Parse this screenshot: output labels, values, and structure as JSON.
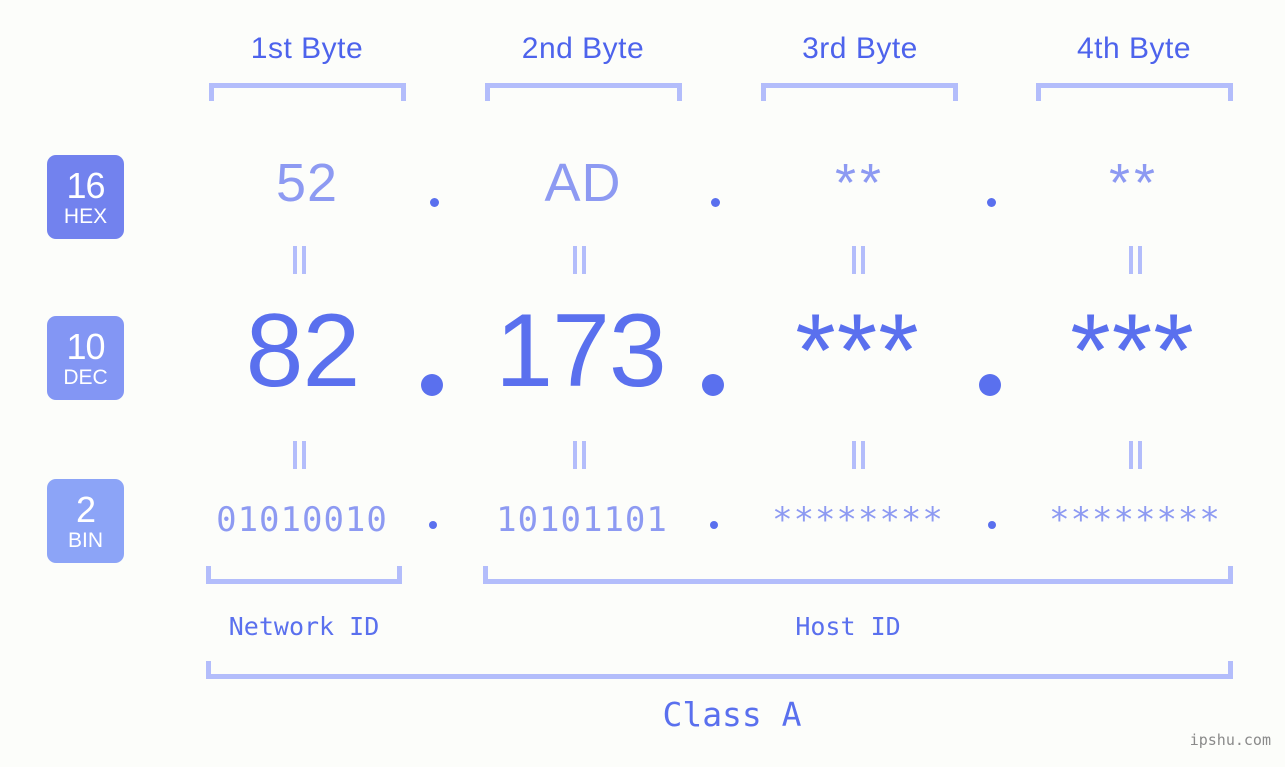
{
  "background_color": "#fcfdfa",
  "accent_colors": {
    "strong_blue": "#5a70ee",
    "light_blue": "#8d9af2",
    "bracket_blue": "#b3bdfb",
    "badge_hex": "#7282ee",
    "badge_dec": "#8396f4",
    "badge_bin": "#8ca4f7",
    "watermark_gray": "#8a8a8a"
  },
  "byte_headers": [
    {
      "label": "1st Byte"
    },
    {
      "label": "2nd Byte"
    },
    {
      "label": "3rd Byte"
    },
    {
      "label": "4th Byte"
    }
  ],
  "radix_badges": [
    {
      "number": "16",
      "name": "HEX",
      "color": "#7282ee"
    },
    {
      "number": "10",
      "name": "DEC",
      "color": "#8396f4"
    },
    {
      "number": "2",
      "name": "BIN",
      "color": "#8ca4f7"
    }
  ],
  "rows": {
    "hex": {
      "radix": "16",
      "radix_name": "HEX",
      "values": [
        "52",
        "AD",
        "**",
        "**"
      ]
    },
    "dec": {
      "radix": "10",
      "radix_name": "DEC",
      "values": [
        "82",
        "173",
        "***",
        "***"
      ]
    },
    "bin": {
      "radix": "2",
      "radix_name": "BIN",
      "values": [
        "01010010",
        "10101101",
        "********",
        "********"
      ]
    }
  },
  "separators": {
    "hex_dots": [
      ".",
      ".",
      "."
    ],
    "dec_dots": [
      ".",
      ".",
      "."
    ],
    "bin_dots": [
      ".",
      ".",
      "."
    ]
  },
  "equals_marks": {
    "count_per_gap": 4,
    "symbol": "="
  },
  "id_sections": [
    {
      "label": "Network ID"
    },
    {
      "label": "Host ID"
    }
  ],
  "class_label": "Class A",
  "watermark": "ipshu.com"
}
